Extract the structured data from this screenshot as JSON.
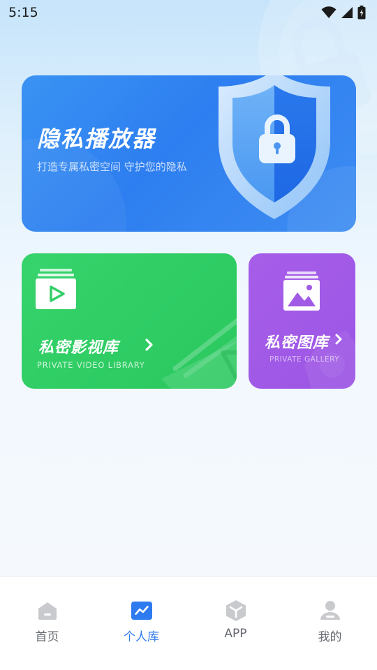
{
  "status_bar": {
    "time": "5:15"
  },
  "hero": {
    "title": "隐私播放器",
    "subtitle": "打造专属私密空间 守护您的隐私",
    "icon": "shield-lock-icon"
  },
  "video_library": {
    "title": "私密影视库",
    "subtitle": "PRIVATE VIDEO LIBRARY",
    "icon": "play-icon"
  },
  "gallery": {
    "title": "私密图库",
    "subtitle": "PRIVATE GALLERY",
    "icon": "image-icon"
  },
  "bottom_nav": {
    "items": [
      {
        "label": "首页",
        "icon": "home-icon",
        "active": false
      },
      {
        "label": "个人库",
        "icon": "library-icon",
        "active": true
      },
      {
        "label": "APP",
        "icon": "box-icon",
        "active": false
      },
      {
        "label": "我的",
        "icon": "user-icon",
        "active": false
      }
    ]
  },
  "colors": {
    "accent": "#2e7bf0",
    "hero_blue": "#3a8cf2",
    "video_green": "#33cf68",
    "gallery_purple": "#a15ae6",
    "nav_inactive": "#666a70",
    "nav_icon_inactive": "#c8cacd"
  }
}
